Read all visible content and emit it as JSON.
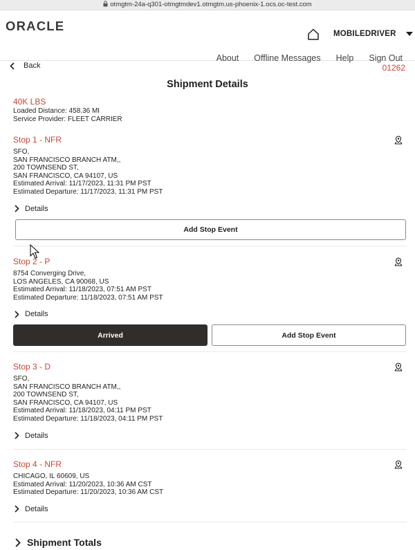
{
  "browser": {
    "url": "otmgtm-24a-q301-otmgtmdev1.otmgtm.us-phoenix-1.ocs.oc-test.com"
  },
  "header": {
    "logo": "ORACLE",
    "user": "MOBILEDRIVER",
    "nav": [
      "About",
      "Offline Messages",
      "Help",
      "Sign Out"
    ]
  },
  "toolbar": {
    "back_label": "Back",
    "shipment_id": "01262"
  },
  "page": {
    "title": "Shipment Details",
    "weight": "40K LBS",
    "loaded_distance": "Loaded Distance: 458.36 MI",
    "service_provider": "Service Provider: FLEET CARRIER"
  },
  "stops": [
    {
      "title": "Stop 1 - NFR",
      "lines": [
        "SFO,",
        "SAN FRANCISCO BRANCH ATM,,",
        "200 TOWNSEND ST,",
        "SAN FRANCISCO, CA 94107, US",
        "Estimated Arrival: 11/17/2023, 11:31 PM PST",
        "Estimated Departure: 11/17/2023, 11:31 PM PST"
      ],
      "details": "Details",
      "add_event": "Add Stop Event"
    },
    {
      "title": "Stop 2 - P",
      "lines": [
        "8754 Converging Drive,",
        "LOS ANGELES, CA 90068, US",
        "Estimated Arrival: 11/18/2023, 07:51 AM PST",
        "Estimated Departure: 11/18/2023, 07:51 AM PST"
      ],
      "details": "Details",
      "arrived": "Arrived",
      "add_event": "Add Stop Event"
    },
    {
      "title": "Stop 3 - D",
      "lines": [
        "SFO,",
        "SAN FRANCISCO BRANCH ATM,,",
        "200 TOWNSEND ST,",
        "SAN FRANCISCO, CA 94107, US",
        "Estimated Arrival: 11/18/2023, 04:11 PM PST",
        "Estimated Departure: 11/18/2023, 04:11 PM PST"
      ],
      "details": "Details"
    },
    {
      "title": "Stop 4 - NFR",
      "lines": [
        "CHICAGO, IL 60609, US",
        "Estimated Arrival: 11/20/2023, 10:36 AM CST",
        "Estimated Departure: 11/20/2023, 10:36 AM CST"
      ],
      "details": "Details"
    }
  ],
  "totals": {
    "label": "Shipment Totals"
  },
  "icons": {
    "lock": "lock-icon",
    "home": "home-icon",
    "caret": "caret-down-icon",
    "back": "chevron-left-icon",
    "chevron": "chevron-right-icon",
    "map": "map-pin-icon"
  },
  "colors": {
    "accent": "#c74634",
    "dark_button": "#312d2a"
  }
}
